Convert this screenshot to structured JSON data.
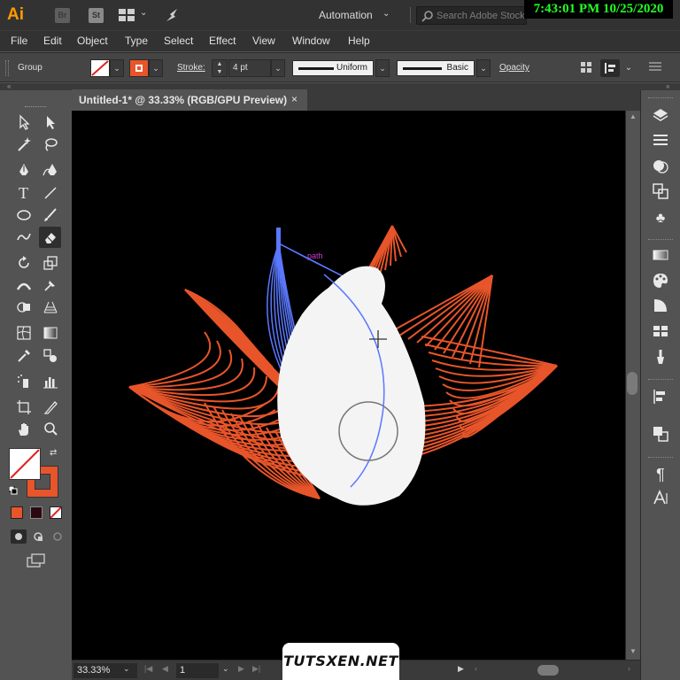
{
  "app": {
    "logo_text": "Ai",
    "bridge_label": "Br",
    "stock_label": "St",
    "workspace": "Automation",
    "search_placeholder": "Search Adobe Stock",
    "clock": "7:43:01 PM 10/25/2020"
  },
  "menu": [
    "File",
    "Edit",
    "Object",
    "Type",
    "Select",
    "Effect",
    "View",
    "Window",
    "Help"
  ],
  "control_bar": {
    "selection_type": "Group",
    "stroke_label": "Stroke:",
    "stroke_weight": "4 pt",
    "variable_width_profile": "Uniform",
    "brush_definition": "Basic",
    "opacity_label": "Opacity",
    "stroke_color": "#e8552a"
  },
  "document": {
    "tab_title": "Untitled-1* @ 33.33% (RGB/GPU Preview)",
    "close_glyph": "×",
    "path_hint": "path"
  },
  "status": {
    "zoom": "33.33%",
    "artboard_number": "1"
  },
  "watermark": "TUTSXEN.NET",
  "colors": {
    "petal_stroke": "#e8552a",
    "selected_path": "#5a78ff",
    "canvas_bg": "#000000",
    "erased_area": "#f4f4f4",
    "smart_guide_label": "#d23cd2",
    "fill_swatch": "#e8552a"
  },
  "icons": {
    "toolbar": [
      "selection-tool-icon",
      "direct-selection-tool-icon",
      "magic-wand-tool-icon",
      "lasso-tool-icon",
      "pen-tool-icon",
      "curvature-tool-icon",
      "type-tool-icon",
      "line-segment-tool-icon",
      "ellipse-tool-icon",
      "paintbrush-tool-icon",
      "shaper-tool-icon",
      "eraser-tool-icon",
      "rotate-tool-icon",
      "scale-tool-icon",
      "width-tool-icon",
      "free-transform-tool-icon",
      "shape-builder-tool-icon",
      "perspective-grid-tool-icon",
      "mesh-tool-icon",
      "gradient-tool-icon",
      "eyedropper-tool-icon",
      "blend-tool-icon",
      "symbol-sprayer-tool-icon",
      "column-graph-tool-icon",
      "artboard-tool-icon",
      "slice-tool-icon",
      "hand-tool-icon",
      "zoom-tool-icon"
    ],
    "dock": [
      "layers-icon",
      "properties-icon",
      "appearance-icon",
      "transform-icon",
      "symbols-icon",
      "gradient-panel-icon",
      "color-panel-icon",
      "transparency-icon",
      "swatches-icon",
      "brushes-icon",
      "align-icon",
      "pathfinder-icon",
      "paragraph-icon",
      "character-icon"
    ]
  }
}
